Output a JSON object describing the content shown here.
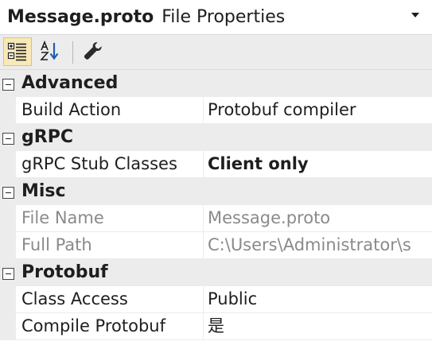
{
  "header": {
    "object_name": "Message.proto",
    "object_type": "File Properties"
  },
  "toolbar": {
    "buttons": [
      {
        "icon": "categorized-icon",
        "active": true
      },
      {
        "icon": "alphabetical-sort-icon",
        "active": false
      },
      {
        "icon": "property-pages-wrench-icon",
        "active": false
      }
    ]
  },
  "grid": {
    "categories": [
      {
        "label": "Advanced",
        "properties": [
          {
            "name": "Build Action",
            "value": "Protobuf compiler",
            "readonly": false,
            "bold": false
          }
        ]
      },
      {
        "label": "gRPC",
        "properties": [
          {
            "name": "gRPC Stub Classes",
            "value": "Client only",
            "readonly": false,
            "bold": true
          }
        ]
      },
      {
        "label": "Misc",
        "properties": [
          {
            "name": "File Name",
            "value": "Message.proto",
            "readonly": true,
            "bold": false
          },
          {
            "name": "Full Path",
            "value": "C:\\Users\\Administrator\\s",
            "readonly": true,
            "bold": false
          }
        ]
      },
      {
        "label": "Protobuf",
        "properties": [
          {
            "name": "Class Access",
            "value": "Public",
            "readonly": false,
            "bold": false
          },
          {
            "name": "Compile Protobuf",
            "value": "是",
            "readonly": false,
            "bold": false
          }
        ]
      }
    ]
  }
}
